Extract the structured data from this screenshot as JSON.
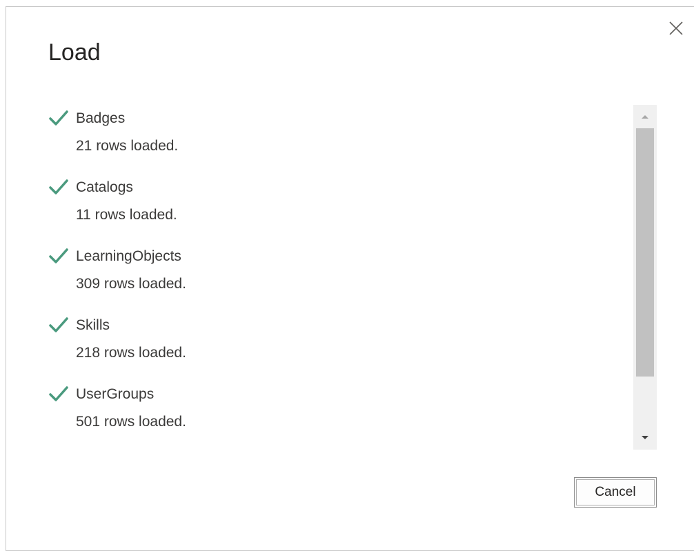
{
  "dialog": {
    "title": "Load",
    "cancel_label": "Cancel"
  },
  "items": [
    {
      "name": "Badges",
      "status": "21 rows loaded."
    },
    {
      "name": "Catalogs",
      "status": "11 rows loaded."
    },
    {
      "name": "LearningObjects",
      "status": "309 rows loaded."
    },
    {
      "name": "Skills",
      "status": "218 rows loaded."
    },
    {
      "name": "UserGroups",
      "status": "501 rows loaded."
    }
  ],
  "icons": {
    "check": "check-icon",
    "close": "close-icon",
    "scroll_up": "chevron-up-icon",
    "scroll_down": "chevron-down-icon"
  },
  "colors": {
    "check": "#4a9a7e",
    "text": "#3b3a39",
    "scroll_thumb": "#c1c1c1",
    "scroll_track": "#f0f0f0"
  }
}
